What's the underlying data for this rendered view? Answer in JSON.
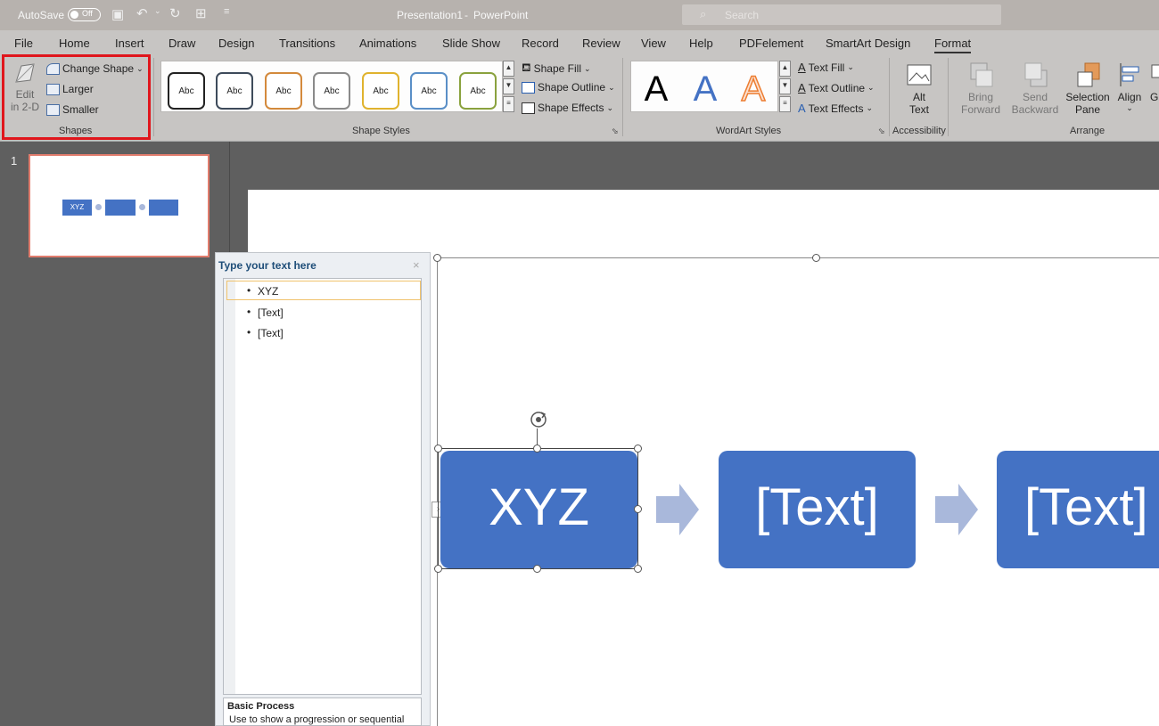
{
  "titlebar": {
    "autosave": "AutoSave",
    "toggle": "Off",
    "title": "Presentation1",
    "sep": "-",
    "app": "PowerPoint",
    "search_placeholder": "Search"
  },
  "tabs": [
    "File",
    "Home",
    "Insert",
    "Draw",
    "Design",
    "Transitions",
    "Animations",
    "Slide Show",
    "Record",
    "Review",
    "View",
    "Help",
    "PDFelement",
    "SmartArt Design",
    "Format"
  ],
  "active_tab": "Format",
  "ribbon": {
    "shapes": {
      "edit_line1": "Edit",
      "edit_line2": "in 2-D",
      "change_shape": "Change Shape",
      "larger": "Larger",
      "smaller": "Smaller",
      "label": "Shapes"
    },
    "shape_styles": {
      "items": [
        "Abc",
        "Abc",
        "Abc",
        "Abc",
        "Abc",
        "Abc",
        "Abc"
      ],
      "border_colors": [
        "#222222",
        "#3d4a5a",
        "#d3893b",
        "#8a8a8a",
        "#e0b32e",
        "#5a8fc7",
        "#8aa23e"
      ],
      "fill": "Shape Fill",
      "outline": "Shape Outline",
      "effects": "Shape Effects",
      "label": "Shape Styles"
    },
    "wordart": {
      "items": [
        "A",
        "A",
        "A"
      ],
      "fill": "Text Fill",
      "outline": "Text Outline",
      "effects": "Text Effects",
      "label": "WordArt Styles"
    },
    "accessibility": {
      "line1": "Alt",
      "line2": "Text",
      "label": "Accessibility"
    },
    "arrange": {
      "bring_line1": "Bring",
      "bring_line2": "Forward",
      "send_line1": "Send",
      "send_line2": "Backward",
      "sel_line1": "Selection",
      "sel_line2": "Pane",
      "align": "Align",
      "more": "G",
      "label": "Arrange"
    }
  },
  "slide_panel": {
    "number": "1",
    "thumb_box1": "XYZ"
  },
  "text_pane": {
    "title": "Type your text here",
    "items": [
      "XYZ",
      "[Text]",
      "[Text]"
    ],
    "desc_title": "Basic Process",
    "desc_text": "Use to show a progression or sequential"
  },
  "smartart": {
    "boxes": [
      "XYZ",
      "[Text]",
      "[Text]"
    ],
    "color": "#4472c4",
    "arrow_color": "#a9b8db"
  },
  "accent": {
    "selection_red": "#e0161c"
  }
}
